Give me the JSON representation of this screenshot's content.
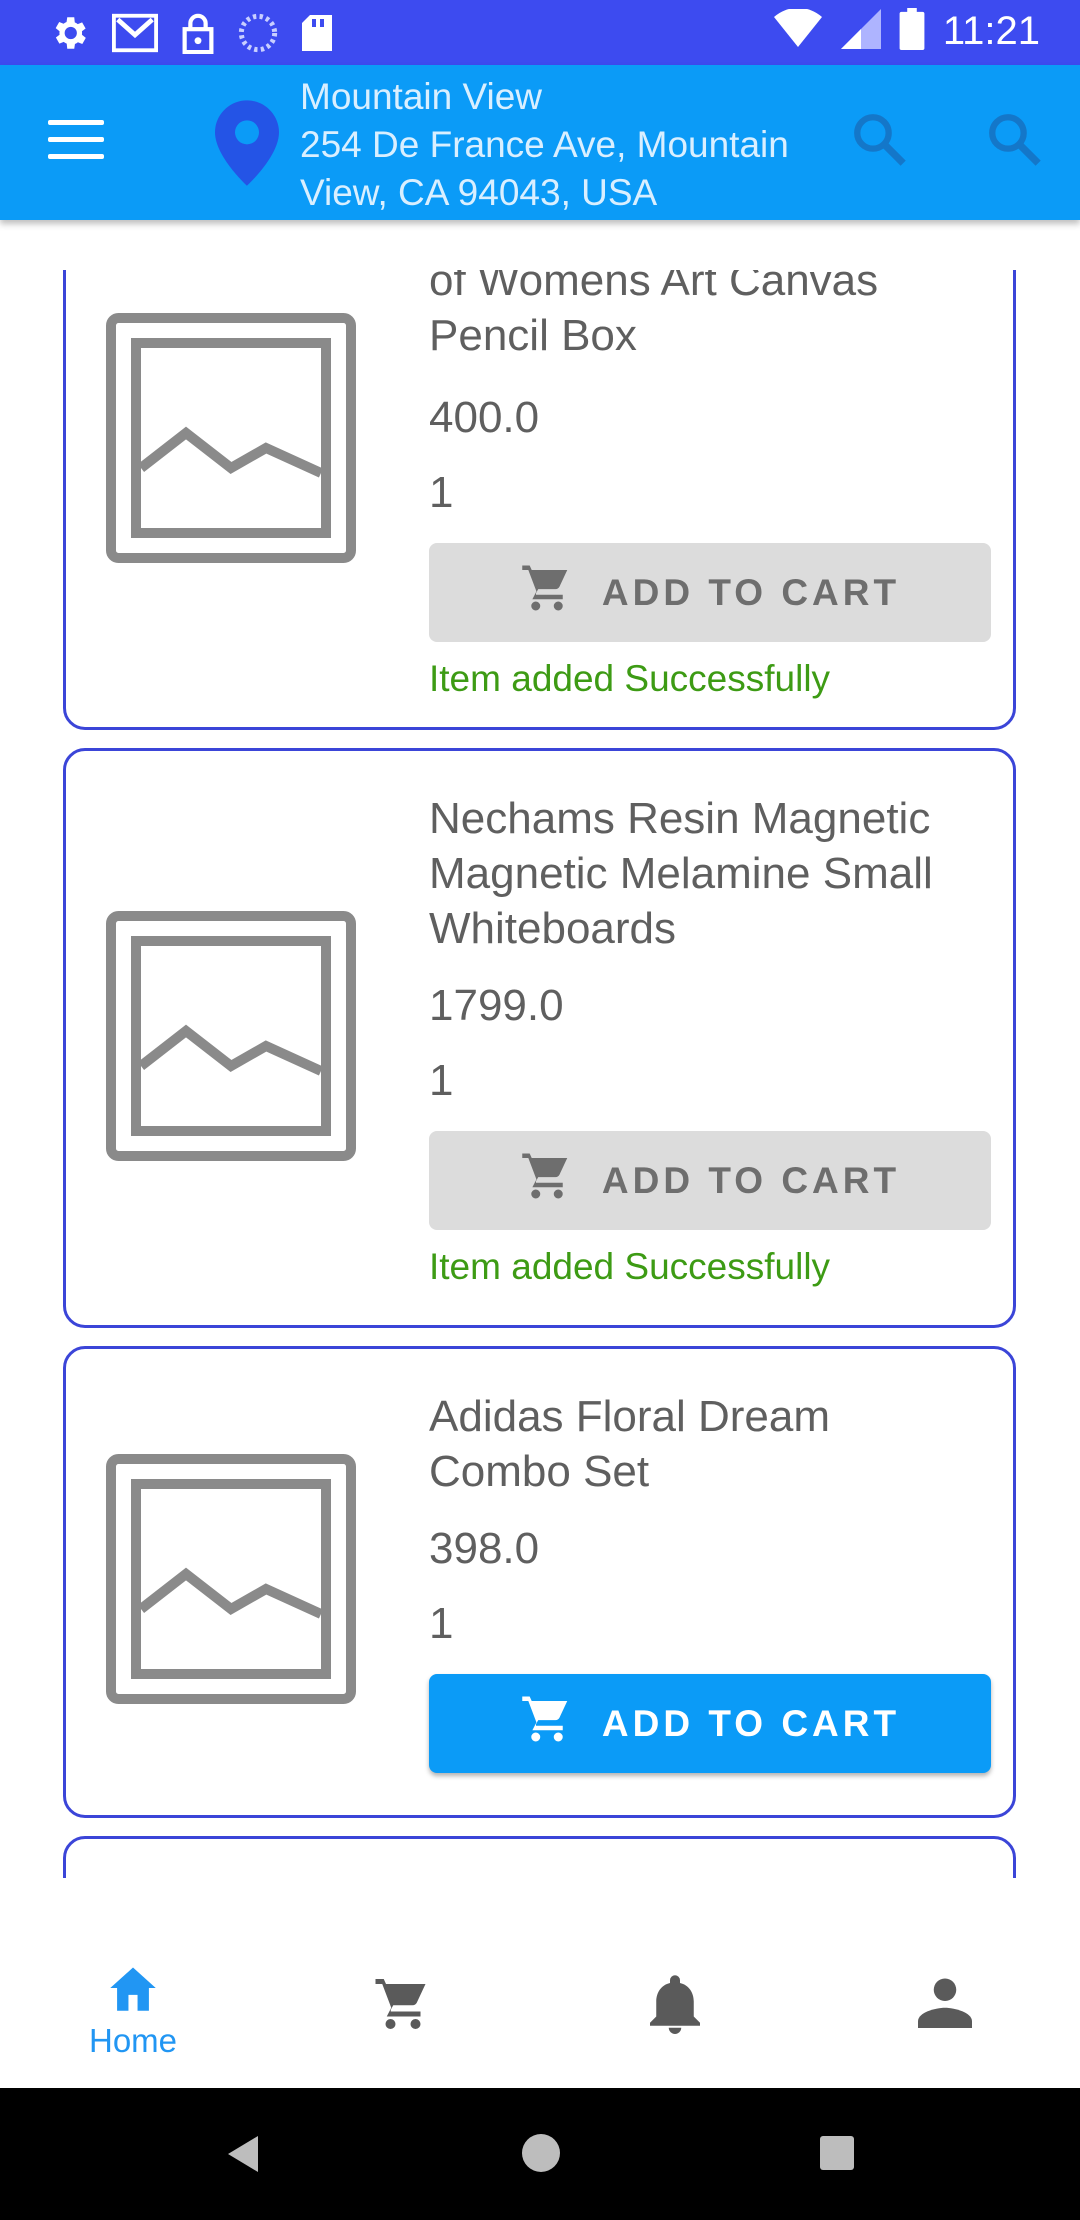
{
  "status_bar": {
    "time": "11:21"
  },
  "app_bar": {
    "location_line1": "Mountain View",
    "location_line2": "254 De France Ave, Mountain",
    "location_line3": "View, CA 94043, USA"
  },
  "products": [
    {
      "name_line1": "of Womens Art Canvas",
      "name_line2": "Pencil Box",
      "price": "400.0",
      "quantity": "1",
      "button_label": "ADD TO CART",
      "status": "Item added Successfully"
    },
    {
      "name_line1": "Nechams Resin Magnetic",
      "name_line2": "Magnetic Melamine Small",
      "name_line3": "Whiteboards",
      "price": "1799.0",
      "quantity": "1",
      "button_label": "ADD TO CART",
      "status": "Item added Successfully"
    },
    {
      "name_line1": "Adidas Floral Dream",
      "name_line2": "Combo Set",
      "price": "398.0",
      "quantity": "1",
      "button_label": "ADD TO CART"
    }
  ],
  "bottom_nav": {
    "home_label": "Home"
  },
  "colors": {
    "status_bar": "#3d4bf0",
    "app_bar": "#0b9bf7",
    "card_border": "#3b45d8",
    "success_text": "#3d9b14",
    "nav_active": "#2196f3"
  },
  "icons": [
    "settings-icon",
    "gmail-icon",
    "lock-icon",
    "sync-icon",
    "sd-card-icon",
    "wifi-icon",
    "signal-icon",
    "battery-icon",
    "menu-icon",
    "location-pin-icon",
    "search-icon",
    "image-placeholder-icon",
    "cart-icon",
    "home-icon",
    "bell-icon",
    "person-icon"
  ]
}
